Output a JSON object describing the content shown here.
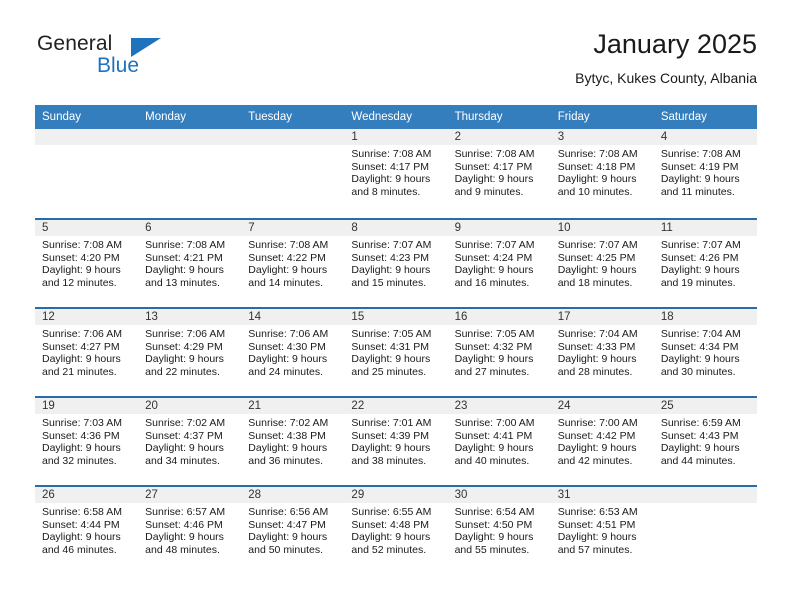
{
  "logo": {
    "primary_text": "General",
    "secondary_text": "Blue",
    "triangle_icon": "triangle-icon",
    "primary_color": "#231f20",
    "accent_color": "#1f72bd"
  },
  "header": {
    "title": "January 2025",
    "subtitle": "Bytyc, Kukes County, Albania"
  },
  "theme": {
    "header_bg": "#357ebd",
    "week_rule": "#2a6ca8",
    "daynum_bg": "#f0f0f0",
    "cell_bg": "#ffffff",
    "text": "#1a1a1a"
  },
  "calendar": {
    "weekday_headers": [
      "Sunday",
      "Monday",
      "Tuesday",
      "Wednesday",
      "Thursday",
      "Friday",
      "Saturday"
    ],
    "weeks": [
      [
        {
          "day": "",
          "lines": []
        },
        {
          "day": "",
          "lines": []
        },
        {
          "day": "",
          "lines": []
        },
        {
          "day": "1",
          "lines": [
            "Sunrise: 7:08 AM",
            "Sunset: 4:17 PM",
            "Daylight: 9 hours",
            "and 8 minutes."
          ]
        },
        {
          "day": "2",
          "lines": [
            "Sunrise: 7:08 AM",
            "Sunset: 4:17 PM",
            "Daylight: 9 hours",
            "and 9 minutes."
          ]
        },
        {
          "day": "3",
          "lines": [
            "Sunrise: 7:08 AM",
            "Sunset: 4:18 PM",
            "Daylight: 9 hours",
            "and 10 minutes."
          ]
        },
        {
          "day": "4",
          "lines": [
            "Sunrise: 7:08 AM",
            "Sunset: 4:19 PM",
            "Daylight: 9 hours",
            "and 11 minutes."
          ]
        }
      ],
      [
        {
          "day": "5",
          "lines": [
            "Sunrise: 7:08 AM",
            "Sunset: 4:20 PM",
            "Daylight: 9 hours",
            "and 12 minutes."
          ]
        },
        {
          "day": "6",
          "lines": [
            "Sunrise: 7:08 AM",
            "Sunset: 4:21 PM",
            "Daylight: 9 hours",
            "and 13 minutes."
          ]
        },
        {
          "day": "7",
          "lines": [
            "Sunrise: 7:08 AM",
            "Sunset: 4:22 PM",
            "Daylight: 9 hours",
            "and 14 minutes."
          ]
        },
        {
          "day": "8",
          "lines": [
            "Sunrise: 7:07 AM",
            "Sunset: 4:23 PM",
            "Daylight: 9 hours",
            "and 15 minutes."
          ]
        },
        {
          "day": "9",
          "lines": [
            "Sunrise: 7:07 AM",
            "Sunset: 4:24 PM",
            "Daylight: 9 hours",
            "and 16 minutes."
          ]
        },
        {
          "day": "10",
          "lines": [
            "Sunrise: 7:07 AM",
            "Sunset: 4:25 PM",
            "Daylight: 9 hours",
            "and 18 minutes."
          ]
        },
        {
          "day": "11",
          "lines": [
            "Sunrise: 7:07 AM",
            "Sunset: 4:26 PM",
            "Daylight: 9 hours",
            "and 19 minutes."
          ]
        }
      ],
      [
        {
          "day": "12",
          "lines": [
            "Sunrise: 7:06 AM",
            "Sunset: 4:27 PM",
            "Daylight: 9 hours",
            "and 21 minutes."
          ]
        },
        {
          "day": "13",
          "lines": [
            "Sunrise: 7:06 AM",
            "Sunset: 4:29 PM",
            "Daylight: 9 hours",
            "and 22 minutes."
          ]
        },
        {
          "day": "14",
          "lines": [
            "Sunrise: 7:06 AM",
            "Sunset: 4:30 PM",
            "Daylight: 9 hours",
            "and 24 minutes."
          ]
        },
        {
          "day": "15",
          "lines": [
            "Sunrise: 7:05 AM",
            "Sunset: 4:31 PM",
            "Daylight: 9 hours",
            "and 25 minutes."
          ]
        },
        {
          "day": "16",
          "lines": [
            "Sunrise: 7:05 AM",
            "Sunset: 4:32 PM",
            "Daylight: 9 hours",
            "and 27 minutes."
          ]
        },
        {
          "day": "17",
          "lines": [
            "Sunrise: 7:04 AM",
            "Sunset: 4:33 PM",
            "Daylight: 9 hours",
            "and 28 minutes."
          ]
        },
        {
          "day": "18",
          "lines": [
            "Sunrise: 7:04 AM",
            "Sunset: 4:34 PM",
            "Daylight: 9 hours",
            "and 30 minutes."
          ]
        }
      ],
      [
        {
          "day": "19",
          "lines": [
            "Sunrise: 7:03 AM",
            "Sunset: 4:36 PM",
            "Daylight: 9 hours",
            "and 32 minutes."
          ]
        },
        {
          "day": "20",
          "lines": [
            "Sunrise: 7:02 AM",
            "Sunset: 4:37 PM",
            "Daylight: 9 hours",
            "and 34 minutes."
          ]
        },
        {
          "day": "21",
          "lines": [
            "Sunrise: 7:02 AM",
            "Sunset: 4:38 PM",
            "Daylight: 9 hours",
            "and 36 minutes."
          ]
        },
        {
          "day": "22",
          "lines": [
            "Sunrise: 7:01 AM",
            "Sunset: 4:39 PM",
            "Daylight: 9 hours",
            "and 38 minutes."
          ]
        },
        {
          "day": "23",
          "lines": [
            "Sunrise: 7:00 AM",
            "Sunset: 4:41 PM",
            "Daylight: 9 hours",
            "and 40 minutes."
          ]
        },
        {
          "day": "24",
          "lines": [
            "Sunrise: 7:00 AM",
            "Sunset: 4:42 PM",
            "Daylight: 9 hours",
            "and 42 minutes."
          ]
        },
        {
          "day": "25",
          "lines": [
            "Sunrise: 6:59 AM",
            "Sunset: 4:43 PM",
            "Daylight: 9 hours",
            "and 44 minutes."
          ]
        }
      ],
      [
        {
          "day": "26",
          "lines": [
            "Sunrise: 6:58 AM",
            "Sunset: 4:44 PM",
            "Daylight: 9 hours",
            "and 46 minutes."
          ]
        },
        {
          "day": "27",
          "lines": [
            "Sunrise: 6:57 AM",
            "Sunset: 4:46 PM",
            "Daylight: 9 hours",
            "and 48 minutes."
          ]
        },
        {
          "day": "28",
          "lines": [
            "Sunrise: 6:56 AM",
            "Sunset: 4:47 PM",
            "Daylight: 9 hours",
            "and 50 minutes."
          ]
        },
        {
          "day": "29",
          "lines": [
            "Sunrise: 6:55 AM",
            "Sunset: 4:48 PM",
            "Daylight: 9 hours",
            "and 52 minutes."
          ]
        },
        {
          "day": "30",
          "lines": [
            "Sunrise: 6:54 AM",
            "Sunset: 4:50 PM",
            "Daylight: 9 hours",
            "and 55 minutes."
          ]
        },
        {
          "day": "31",
          "lines": [
            "Sunrise: 6:53 AM",
            "Sunset: 4:51 PM",
            "Daylight: 9 hours",
            "and 57 minutes."
          ]
        },
        {
          "day": "",
          "lines": []
        }
      ]
    ]
  }
}
